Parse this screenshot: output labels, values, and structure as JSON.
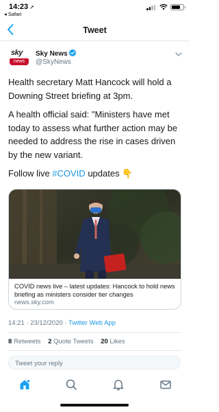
{
  "status_bar": {
    "time": "14:23",
    "back_app": "◂ Safari"
  },
  "nav": {
    "title": "Tweet"
  },
  "author": {
    "avatar_top": "sky",
    "avatar_bottom": "news",
    "name": "Sky News",
    "handle": "@SkyNews"
  },
  "tweet": {
    "para1": "Health secretary Matt Hancock will hold a Downing Street briefing at 3pm.",
    "para2": "A health official said: \"Ministers have met today to assess what further action may be needed to address the rise in cases driven by the new variant.",
    "para3_prefix": "Follow live ",
    "hashtag": "#COVID",
    "para3_suffix": " updates ",
    "emoji": "👇"
  },
  "card": {
    "title": "COVID news live – latest updates: Hancock to hold news briefing as ministers consider tier changes",
    "domain": "news.sky.com"
  },
  "meta": {
    "timestamp": "14:21 · 23/12/2020 · ",
    "via": "Twitter Web App"
  },
  "stats": {
    "retweets_count": "8",
    "retweets_label": "Retweets",
    "quotes_count": "2",
    "quotes_label": "Quote Tweets",
    "likes_count": "20",
    "likes_label": "Likes"
  },
  "reply": {
    "placeholder": "Tweet your reply"
  },
  "colors": {
    "accent": "#1da1f2",
    "link": "#1b95e0",
    "sky_red": "#c8102e",
    "muted": "#657786"
  },
  "icons": {
    "tabs": [
      "home-icon",
      "search-icon",
      "notifications-icon",
      "messages-icon"
    ]
  }
}
